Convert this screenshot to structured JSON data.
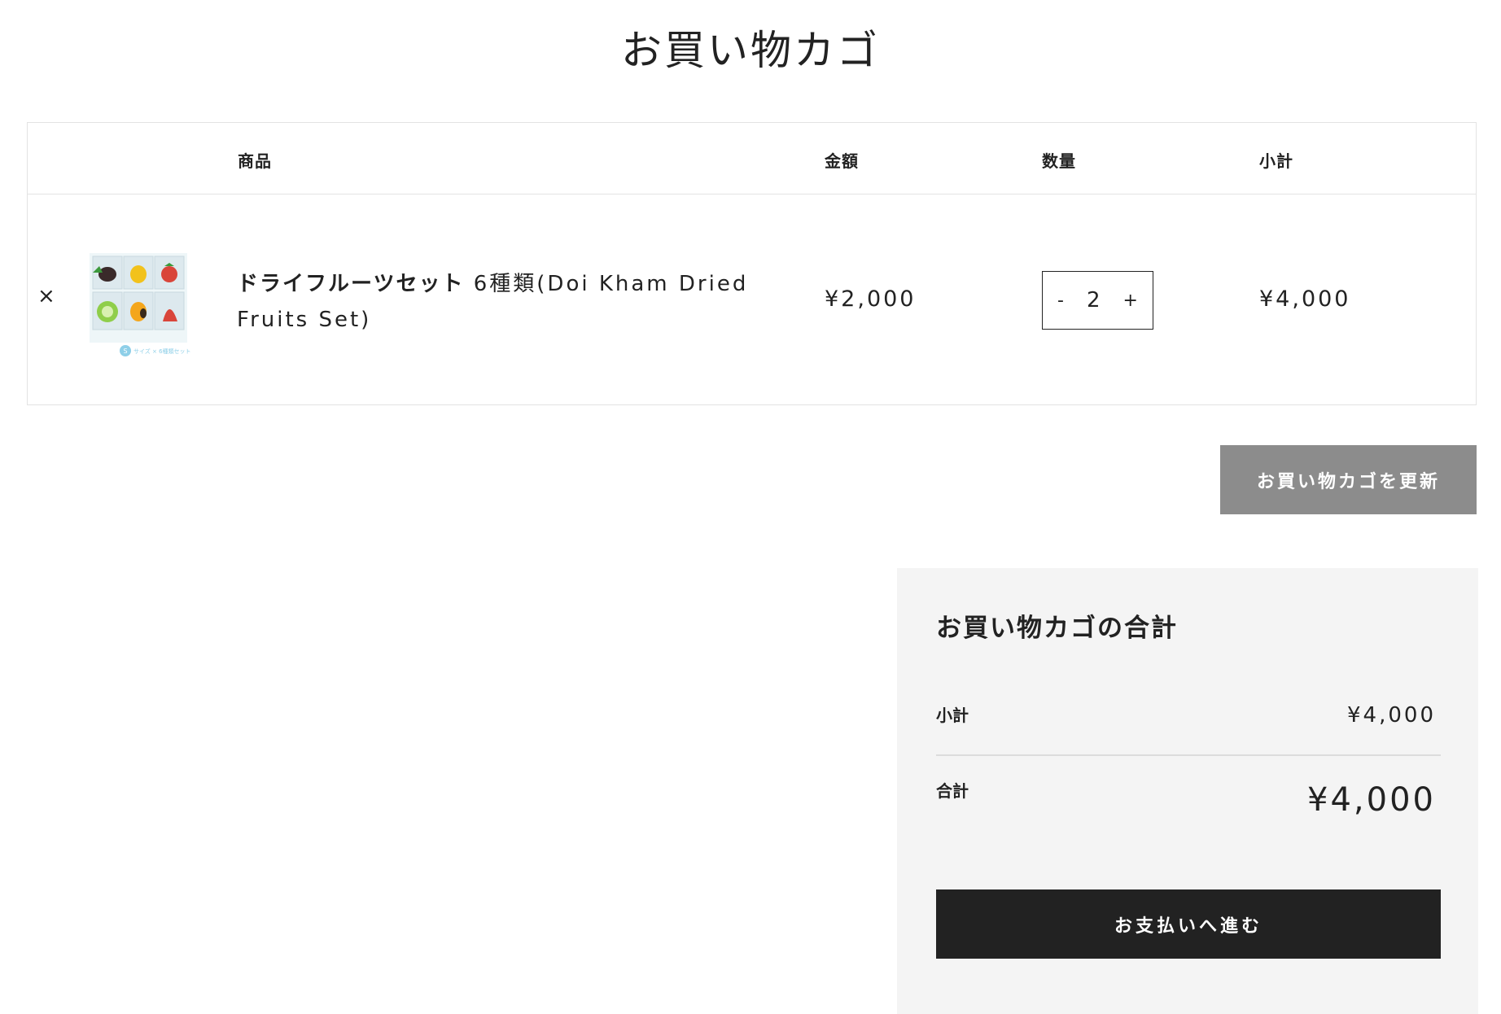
{
  "page": {
    "title": "お買い物カゴ"
  },
  "cart": {
    "headers": {
      "product": "商品",
      "price": "金額",
      "quantity": "数量",
      "subtotal": "小計"
    },
    "items": [
      {
        "remove_label": "×",
        "name_bold": "ドライフルーツセット",
        "name_rest": " 6種類(Doi Kham Dried Fruits Set)",
        "price": "¥2,000",
        "quantity": "2",
        "qty_minus": "-",
        "qty_plus": "+",
        "subtotal": "¥4,000",
        "thumb_caption": "サイズ × 6種類セット",
        "thumb_badge": "S"
      }
    ]
  },
  "actions": {
    "update_cart": "お買い物カゴを更新"
  },
  "totals": {
    "title": "お買い物カゴの合計",
    "subtotal_label": "小計",
    "subtotal_value": "¥4,000",
    "total_label": "合計",
    "total_value": "¥4,000",
    "checkout": "お支払いへ進む"
  },
  "colors": {
    "update_button": "#8c8c8c",
    "checkout_button": "#222222",
    "totals_bg": "#f4f4f4"
  }
}
